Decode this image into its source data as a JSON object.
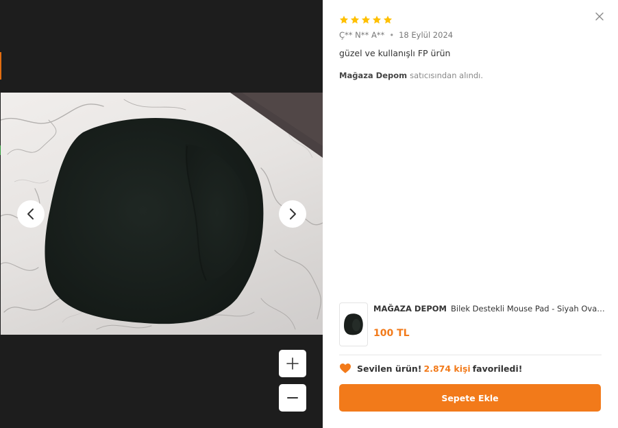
{
  "viewer": {
    "photo_alt": "review photo",
    "prev_icon": "chevron-left-icon",
    "next_icon": "chevron-right-icon",
    "zoom_in_icon": "plus-icon",
    "zoom_out_icon": "minus-icon"
  },
  "review": {
    "rating": 5,
    "rating_max": 5,
    "star_color": "#ffc000",
    "author": "Ç** N** A**",
    "separator": "•",
    "date": "18 Eylül 2024",
    "comment": "güzel ve kullanışlı FP ürün",
    "seller_name": "Mağaza Depom",
    "seller_suffix": "satıcısından alındı."
  },
  "product": {
    "brand": "MAĞAZA DEPOM",
    "name": "Bilek Destekli Mouse Pad - Siyah Oval Mouse Pad",
    "price": "100 TL",
    "price_color": "#f27a1a"
  },
  "favorites": {
    "prefix": "Sevilen ürün!",
    "count": "2.874 kişi",
    "suffix": "favoriledi!",
    "heart_color": "#f27a1a"
  },
  "cart": {
    "label": "Sepete Ekle",
    "color": "#f27a1a"
  },
  "close_icon": "close-icon"
}
